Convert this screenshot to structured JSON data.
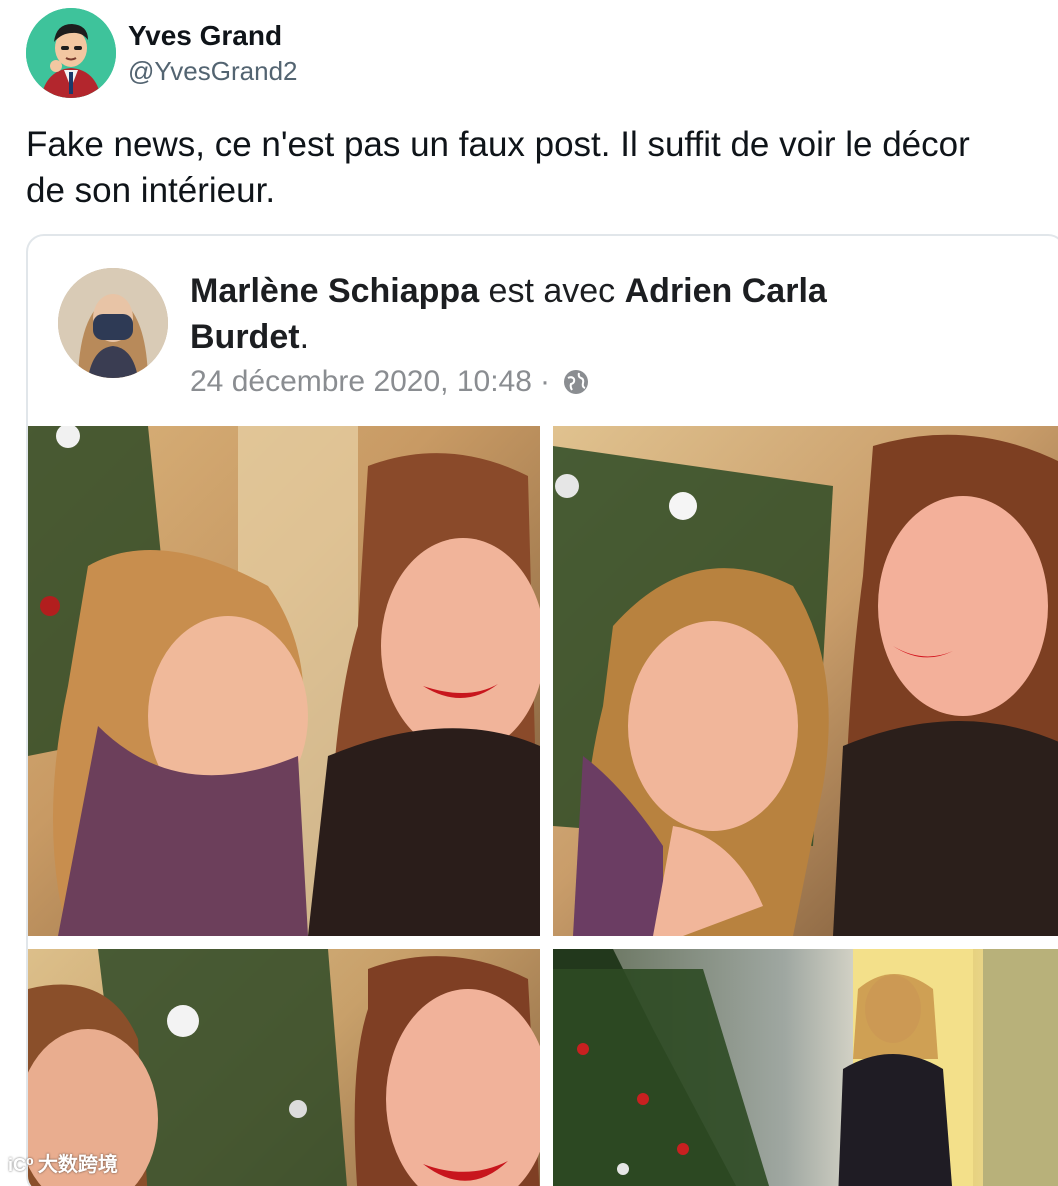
{
  "tweet": {
    "author_name": "Yves Grand",
    "author_handle": "@YvesGrand2",
    "text_line1": "Fake news, ce n'est pas un faux post. Il suffit de voir le décor",
    "text_line2": "de son intérieur."
  },
  "embed": {
    "poster_name": "Marlène Schiappa",
    "with_text": " est avec ",
    "tagged_name": "Adrien Carla",
    "tagged_name_2": "Burdet",
    "period": ".",
    "timestamp": "24 décembre 2020, 10:48",
    "separator": "·",
    "privacy_icon": "globe-icon"
  },
  "watermark": {
    "logo": "iC⁰",
    "text": "大数跨境"
  }
}
